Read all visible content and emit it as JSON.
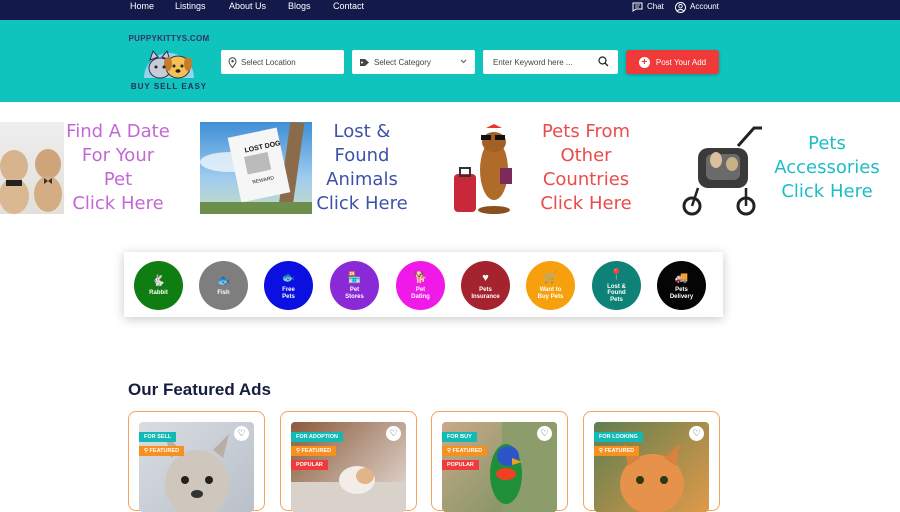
{
  "nav": {
    "links": [
      "Home",
      "Listings",
      "About Us",
      "Blogs",
      "Contact"
    ],
    "chat": "Chat",
    "account": "Account"
  },
  "header": {
    "logo_name": "PUPPYKITTYS.COM",
    "logo_tagline": "BUY SELL EASY",
    "location_placeholder": "Select Location",
    "category_placeholder": "Select Category",
    "keyword_placeholder": "Enter Keyword here ...",
    "post_button": "Post Your Add"
  },
  "banners": [
    {
      "text": "Find A Date\nFor Your\nPet\nClick Here",
      "color": "#c467d6"
    },
    {
      "text": "Lost &\nFound\nAnimals\nClick Here",
      "color": "#3d52a8",
      "sign": "LOST DOG",
      "sign2": "REWARD"
    },
    {
      "text": "Pets From\nOther\nCountries\nClick Here",
      "color": "#ea4b4b"
    },
    {
      "text": "Pets\nAccessories\nClick Here",
      "color": "#1cbcc8"
    }
  ],
  "categories": [
    {
      "label": "Rabbit",
      "color": "#0f7d12",
      "icon": "rabbit-icon",
      "glyph": "🐇"
    },
    {
      "label": "Fish",
      "color": "#7e7e7e",
      "icon": "fish-icon",
      "glyph": "🐟"
    },
    {
      "label": "Free\nPets",
      "color": "#0b10e0",
      "icon": "fish-icon",
      "glyph": "🐟"
    },
    {
      "label": "Pet\nStores",
      "color": "#8a2ad6",
      "icon": "store-icon",
      "glyph": "🏪"
    },
    {
      "label": "Pet\nDating",
      "color": "#f01ae8",
      "icon": "dog-icon",
      "glyph": "🐕"
    },
    {
      "label": "Pets\nInsurance",
      "color": "#a5232f",
      "icon": "heart-pulse-icon",
      "glyph": "♥"
    },
    {
      "label": "Want to\nBuy Pets",
      "color": "#f7a00d",
      "icon": "cart-icon",
      "glyph": "🛒"
    },
    {
      "label": "Lost &\nFound\nPets",
      "color": "#0f8278",
      "icon": "map-pin-icon",
      "glyph": "📍"
    },
    {
      "label": "Pets\nDelivery",
      "color": "#050505",
      "icon": "truck-icon",
      "glyph": "🚚"
    }
  ],
  "featured": {
    "title": "Our Featured Ads",
    "cards": [
      {
        "status": "FOR SELL",
        "featured": "FEATURED",
        "popular": ""
      },
      {
        "status": "FOR ADOPTION",
        "featured": "FEATURED",
        "popular": "POPULAR"
      },
      {
        "status": "FOR BUY",
        "featured": "FEATURED",
        "popular": "POPULAR"
      },
      {
        "status": "FOR LOOKING",
        "featured": "FEATURED",
        "popular": ""
      }
    ]
  },
  "colors": {
    "nav_bg": "#131a4a",
    "header_bg": "#0fc4bc",
    "accent_red": "#f03a3a",
    "badge_teal": "#13b9b5",
    "badge_orange": "#f6901f",
    "badge_red": "#ee3b3b"
  }
}
